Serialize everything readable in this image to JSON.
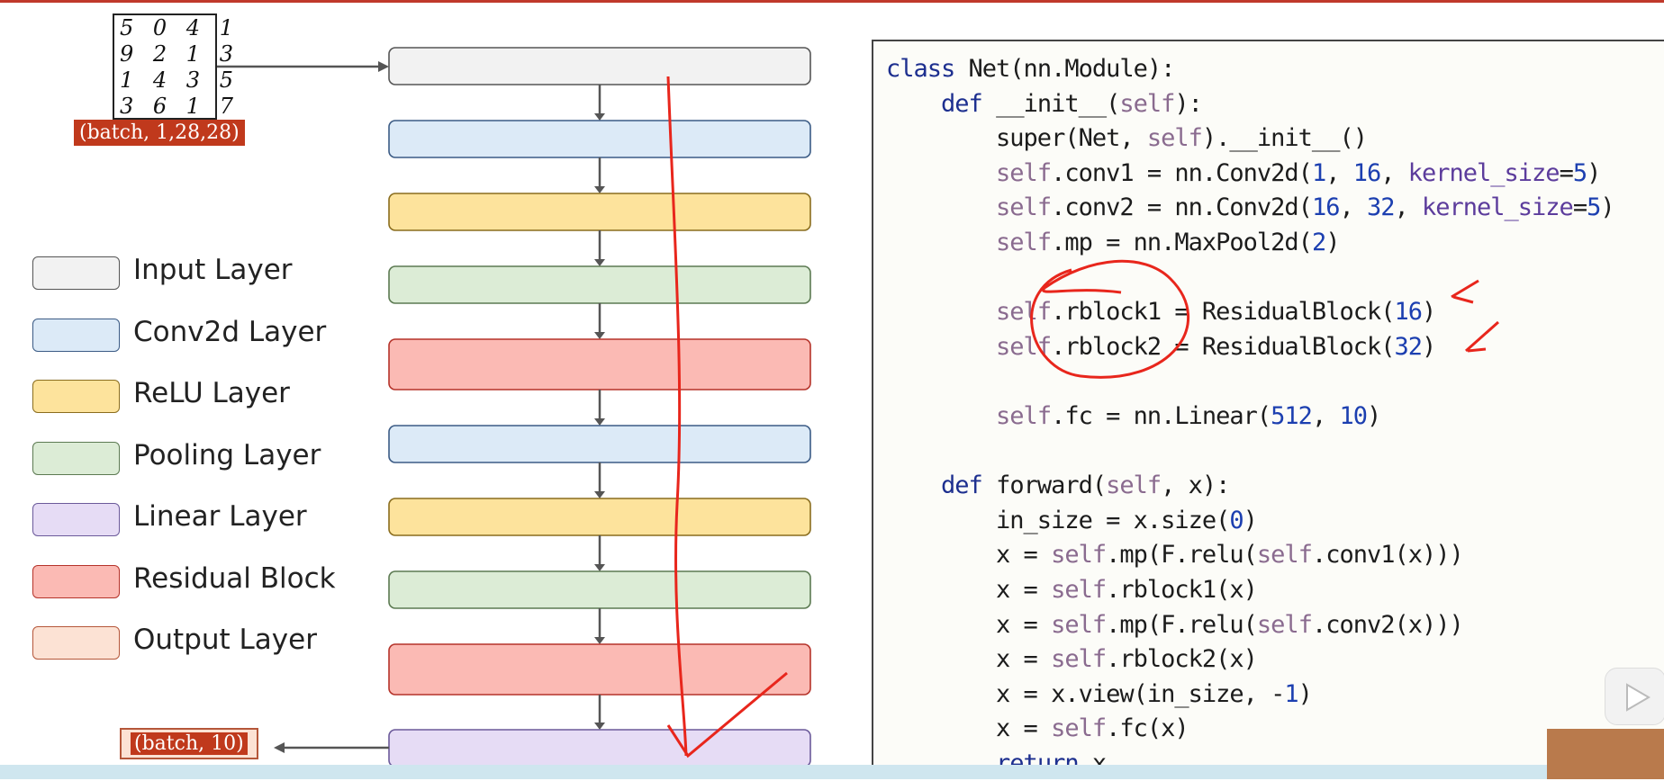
{
  "input_digits": {
    "rows": [
      "5 0 4 1",
      "9 2 1 3",
      "1 4 3 5",
      "3 6 1 7"
    ]
  },
  "input_shape": "(batch, 1,28,28)",
  "output_shape": "(batch, 10)",
  "legend": [
    {
      "label": "Input Layer",
      "fill": "#f2f2f2",
      "stroke": "#555555"
    },
    {
      "label": "Conv2d Layer",
      "fill": "#dceaf7",
      "stroke": "#3b5b85"
    },
    {
      "label": "ReLU Layer",
      "fill": "#fde39c",
      "stroke": "#8a6d1e"
    },
    {
      "label": "Pooling Layer",
      "fill": "#dcecd6",
      "stroke": "#5c7a52"
    },
    {
      "label": "Linear Layer",
      "fill": "#e6dcf5",
      "stroke": "#6b5a9a"
    },
    {
      "label": "Residual Block",
      "fill": "#fbbab4",
      "stroke": "#b5332a"
    },
    {
      "label": "Output Layer",
      "fill": "#fce2d4",
      "stroke": "#b5573a"
    }
  ],
  "layer_stack": [
    "Input Layer",
    "Conv2d Layer",
    "ReLU Layer",
    "Pooling Layer",
    "Residual Block",
    "Conv2d Layer",
    "ReLU Layer",
    "Pooling Layer",
    "Residual Block",
    "Linear Layer"
  ],
  "code_lines": [
    "class Net(nn.Module):",
    "    def __init__(self):",
    "        super(Net, self).__init__()",
    "        self.conv1 = nn.Conv2d(1, 16, kernel_size=5)",
    "        self.conv2 = nn.Conv2d(16, 32, kernel_size=5)",
    "        self.mp = nn.MaxPool2d(2)",
    "",
    "        self.rblock1 = ResidualBlock(16)",
    "        self.rblock2 = ResidualBlock(32)",
    "",
    "        self.fc = nn.Linear(512, 10)",
    "",
    "    def forward(self, x):",
    "        in_size = x.size(0)",
    "        x = self.mp(F.relu(self.conv1(x)))",
    "        x = self.rblock1(x)",
    "        x = self.mp(F.relu(self.conv2(x)))",
    "        x = self.rblock2(x)",
    "        x = x.view(in_size, -1)",
    "        x = self.fc(x)",
    "        return x"
  ],
  "colors": {
    "annotation": "#e8261c",
    "arrow": "#555555",
    "tag": "#c0391c"
  }
}
